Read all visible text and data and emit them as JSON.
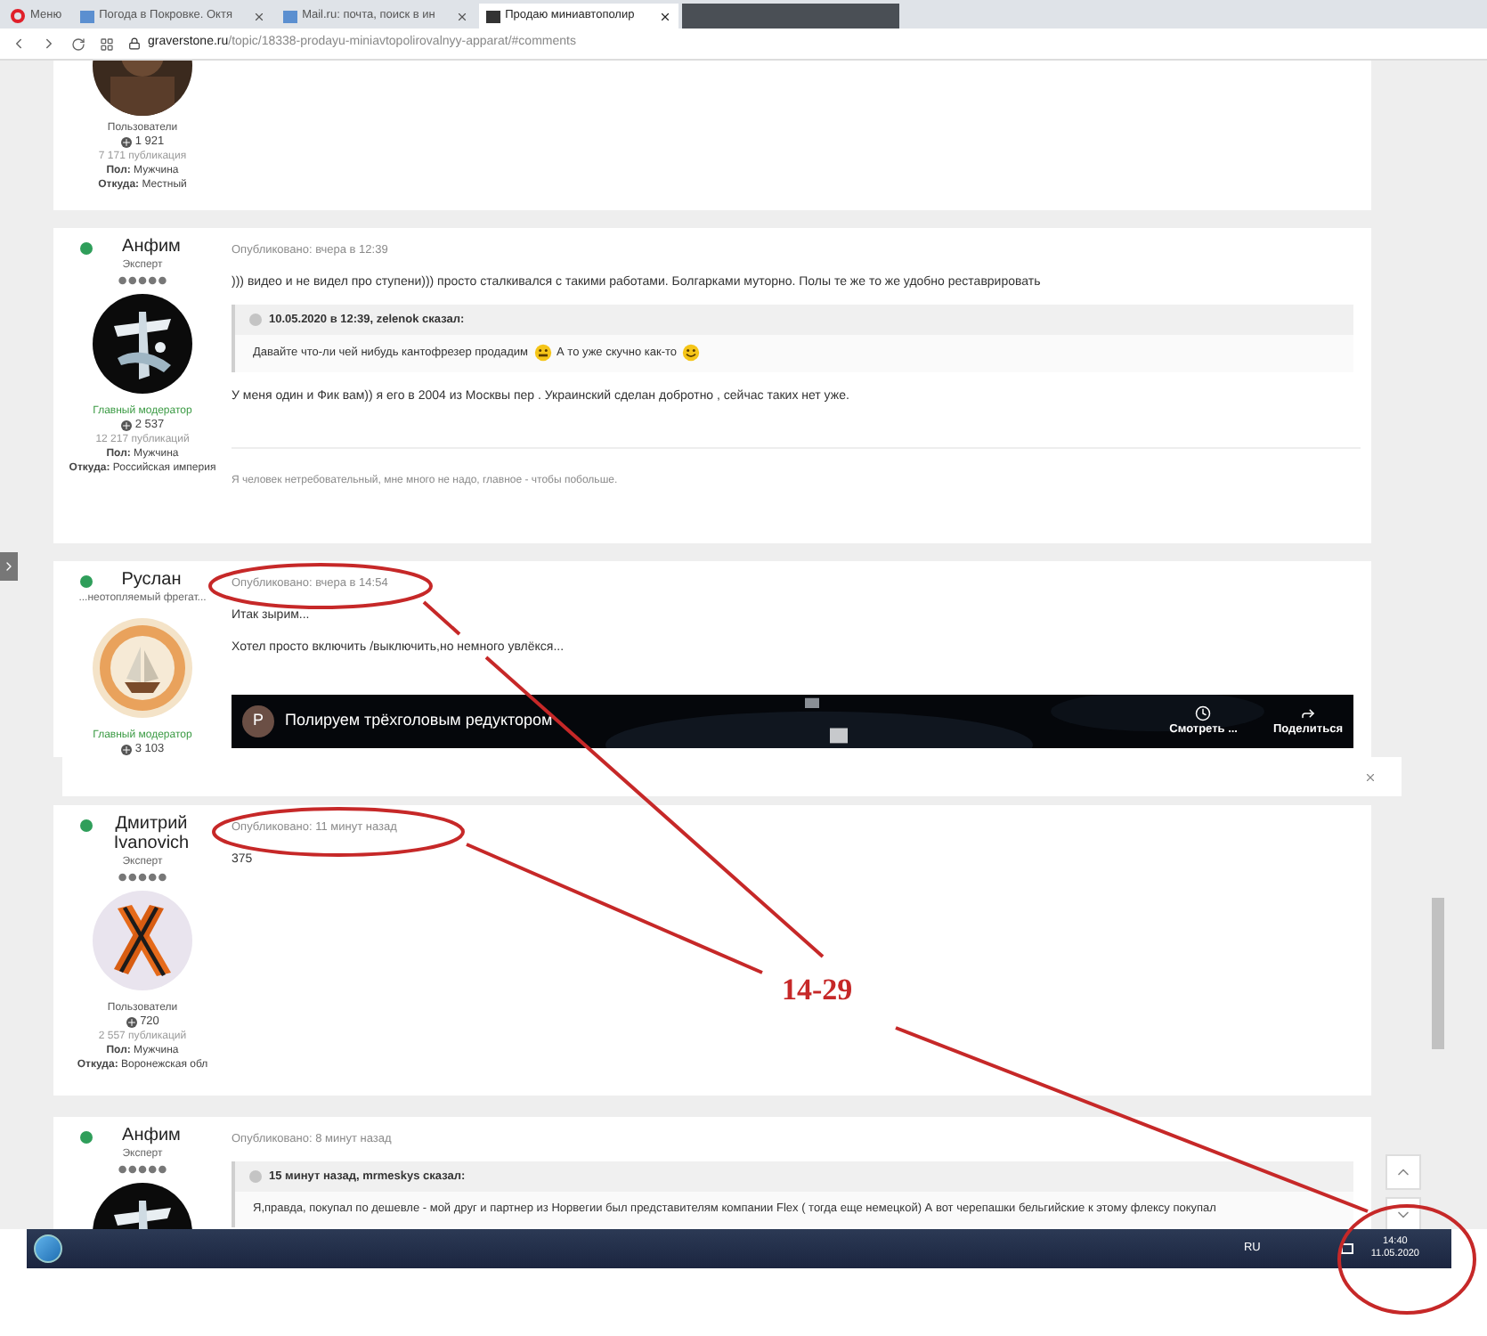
{
  "browser": {
    "tabs": [
      {
        "label": "Меню",
        "kind": "menu",
        "selected": false
      },
      {
        "label": "Погода в Покровке. Октя",
        "kind": "page",
        "selected": false
      },
      {
        "label": "Mail.ru: почта, поиск в ин",
        "kind": "page",
        "selected": false
      },
      {
        "label": "Продаю миниавтополир",
        "kind": "page",
        "selected": true
      }
    ],
    "url_domain": "graverstone.ru",
    "url_path": "/topic/18338-prodayu-miniavtopolirovalnyy-apparat/#comments"
  },
  "posts": [
    {
      "author": {
        "group": {
          "label": "Пользователи",
          "kind": "user"
        },
        "reputation": "1 921",
        "posts_count": "7 171 публикация",
        "gender_label": "Пол:",
        "gender": "Мужчина",
        "location_label": "Откуда:",
        "location": "Местный"
      }
    },
    {
      "author": {
        "name": "Анфим",
        "online": true,
        "title": "Эксперт",
        "avatar": {
          "kind": "calligraphy"
        },
        "group": {
          "label": "Главный модератор",
          "kind": "moderator"
        },
        "reputation": "2 537",
        "posts_count": "12 217 публикаций",
        "gender_label": "Пол:",
        "gender": "Мужчина",
        "location_label": "Откуда:",
        "location": "Российская империя"
      },
      "date": "Опубликовано: вчера в 12:39",
      "blocks": [
        {
          "kind": "text",
          "text": "))) видео и не видел про ступени))) просто сталкивался с такими работами. Болгарками муторно. Полы те же то же удобно реставрировать"
        },
        {
          "kind": "quote",
          "header": "10.05.2020 в 12:39, zelenok сказал:",
          "segments": [
            {
              "kind": "text",
              "text": "Давайте что-ли чей нибудь кантофрезер продадим"
            },
            {
              "kind": "grimace"
            },
            {
              "kind": "text",
              "text": "А то уже скучно как-то"
            },
            {
              "kind": "smile"
            }
          ]
        },
        {
          "kind": "text",
          "text": "У меня один и Фик вам)) я его в 2004 из Москвы пер . Украинский сделан добротно , сейчас таких нет уже."
        },
        {
          "kind": "signature",
          "text": "Я человек нетребовательный, мне много не надо, главное - чтобы побольше."
        }
      ]
    },
    {
      "author": {
        "name": "Руслан",
        "online": true,
        "title": "...неотопляемый фрегат...",
        "avatar": {
          "kind": "ship"
        },
        "group": {
          "label": "Главный модератор",
          "kind": "moderator"
        },
        "reputation": "3 103"
      },
      "date": "Опубликовано: вчера в 14:54",
      "blocks": [
        {
          "kind": "text",
          "text": "Итак зырим..."
        },
        {
          "kind": "text",
          "text": "Хотел просто включить /выключить,но немного увлёкся..."
        },
        {
          "kind": "video",
          "channel": "P",
          "title": "Полируем трёхголовым редуктором",
          "watch": "Смотреть ...",
          "share": "Поделиться"
        }
      ]
    },
    {
      "author": {
        "name": "Дмитрий Ivanovich",
        "online": true,
        "title": "Эксперт",
        "avatar": {
          "kind": "ribbon"
        },
        "group": {
          "label": "Пользователи",
          "kind": "user"
        },
        "reputation": "720",
        "posts_count": "2 557 публикаций",
        "gender_label": "Пол:",
        "gender": "Мужчина",
        "location_label": "Откуда:",
        "location": "Воронежская обл"
      },
      "date": "Опубликовано: 11 минут назад",
      "blocks": [
        {
          "kind": "text",
          "text": "375"
        }
      ]
    },
    {
      "author": {
        "name": "Анфим",
        "online": true,
        "title": "Эксперт",
        "avatar": {
          "kind": "calligraphy"
        }
      },
      "date": "Опубликовано: 8 минут назад",
      "blocks": [
        {
          "kind": "quote",
          "header": "15 минут назад, mrmeskys сказал:",
          "segments": [
            {
              "kind": "text",
              "text": "Я,правда,  покупал по дешевле - мой друг и партнер из Норвегии был представителям компании Flex  ( тогда еще немецкой)  А вот  черепашки бельгийские к этому флексу покупал"
            }
          ]
        }
      ]
    }
  ],
  "taskbar": {
    "language": "RU",
    "time": "14:40",
    "date": "11.05.2020"
  },
  "annotation": {
    "label": "14-29"
  }
}
